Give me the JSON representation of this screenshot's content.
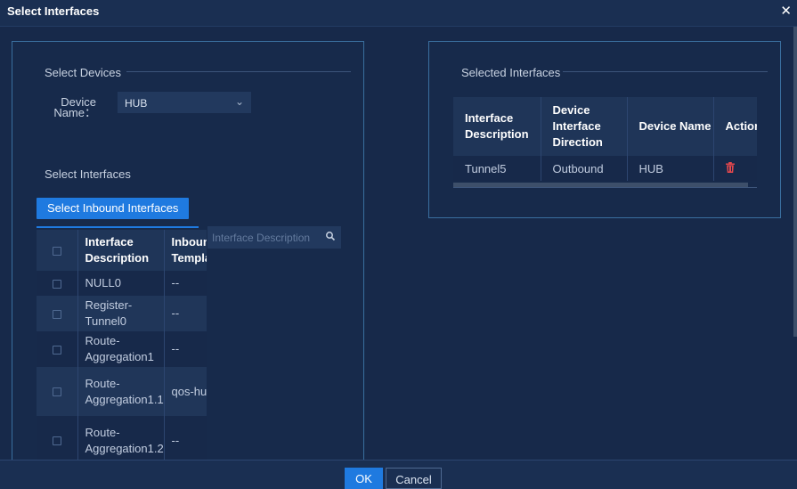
{
  "dialog": {
    "title": "Select Interfaces",
    "close_glyph": "✕"
  },
  "left": {
    "select_devices_title": "Select Devices",
    "device_name_label": "Device Name：",
    "device_value": "HUB",
    "select_interfaces_title": "Select Interfaces",
    "inbound_button": "Select Inbound Interfaces",
    "search_placeholder": "Interface Description",
    "columns": [
      "",
      "Interface Description",
      "Inbound Template"
    ],
    "rows": [
      {
        "desc": "NULL0",
        "tpl": "--"
      },
      {
        "desc": "Register-Tunnel0",
        "tpl": "--"
      },
      {
        "desc": "Route-Aggregation1",
        "tpl": "--"
      },
      {
        "desc": "Route-Aggregation1.1",
        "tpl": "qos-hub"
      },
      {
        "desc": "Route-Aggregation1.2",
        "tpl": "--"
      }
    ]
  },
  "right": {
    "selected_title": "Selected Interfaces",
    "columns": [
      "Interface Description",
      "Device Interface Direction",
      "Device Name",
      "Action"
    ],
    "rows": [
      {
        "desc": "Tunnel5",
        "direction": "Outbound",
        "device": "HUB",
        "action_icon": "trash-icon"
      }
    ]
  },
  "footer": {
    "ok": "OK",
    "cancel": "Cancel"
  },
  "colors": {
    "accent": "#1f7ae0",
    "delete": "#e5484d",
    "background": "#17294a"
  }
}
